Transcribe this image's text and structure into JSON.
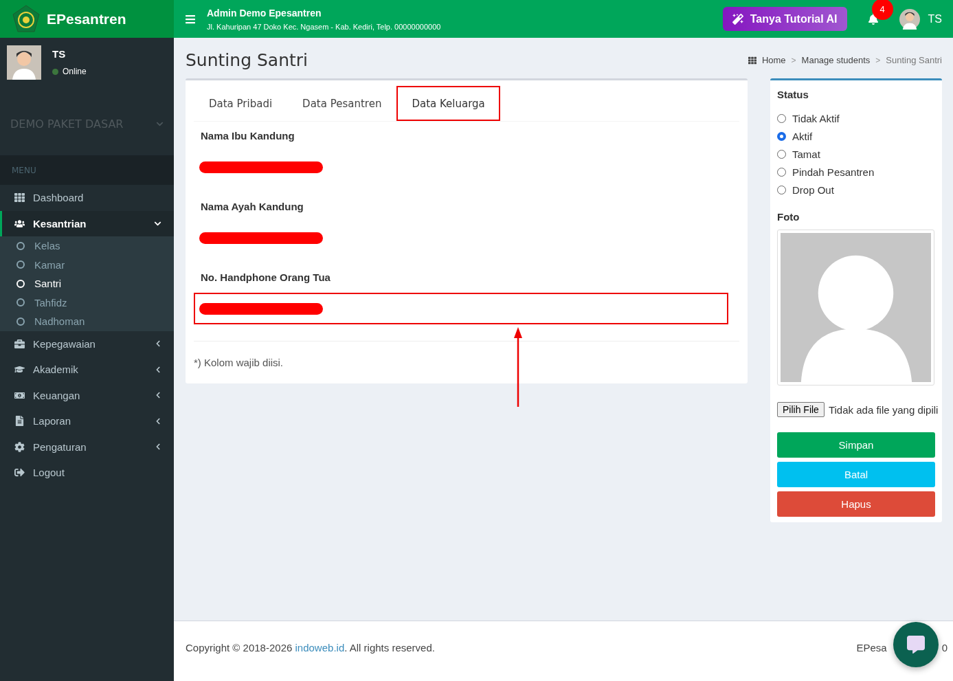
{
  "brand": "EPesantren",
  "header": {
    "title": "Admin Demo Epesantren",
    "address": "Jl. Kahuripan 47 Doko Kec. Ngasem - Kab. Kediri, Telp. 00000000000",
    "ai_button": "Tanya Tutorial AI",
    "notification_count": "4",
    "user_name": "TS"
  },
  "sidebar": {
    "user": {
      "name": "TS",
      "status": "Online"
    },
    "package": "DEMO PAKET DASAR",
    "menu_header": "MENU",
    "items": [
      {
        "label": "Dashboard",
        "kind": "link",
        "selected": false
      },
      {
        "label": "Kesantrian",
        "kind": "tree",
        "expanded": true,
        "selected": true,
        "children": [
          {
            "label": "Kelas",
            "selected": false
          },
          {
            "label": "Kamar",
            "selected": false
          },
          {
            "label": "Santri",
            "selected": true
          },
          {
            "label": "Tahfidz",
            "selected": false
          },
          {
            "label": "Nadhoman",
            "selected": false
          }
        ]
      },
      {
        "label": "Kepegawaian",
        "kind": "tree",
        "expanded": false,
        "selected": false
      },
      {
        "label": "Akademik",
        "kind": "tree",
        "expanded": false,
        "selected": false
      },
      {
        "label": "Keuangan",
        "kind": "tree",
        "expanded": false,
        "selected": false
      },
      {
        "label": "Laporan",
        "kind": "tree",
        "expanded": false,
        "selected": false
      },
      {
        "label": "Pengaturan",
        "kind": "tree",
        "expanded": false,
        "selected": false
      },
      {
        "label": "Logout",
        "kind": "link",
        "selected": false
      }
    ]
  },
  "page": {
    "title": "Sunting Santri",
    "breadcrumbs": [
      "Home",
      "Manage students",
      "Sunting Santri"
    ],
    "breadcrumb_separators": [
      ">",
      ">"
    ]
  },
  "form": {
    "tabs": [
      {
        "label": "Data Pribadi",
        "selected": false,
        "highlighted": false
      },
      {
        "label": "Data Pesantren",
        "selected": false,
        "highlighted": false
      },
      {
        "label": "Data Keluarga",
        "selected": true,
        "highlighted": true
      }
    ],
    "fields": [
      {
        "label": "Nama Ibu Kandung",
        "redacted": true,
        "highlighted": false,
        "arrow": false
      },
      {
        "label": "Nama Ayah Kandung",
        "redacted": true,
        "highlighted": false,
        "arrow": false
      },
      {
        "label": "No. Handphone Orang Tua",
        "redacted": true,
        "highlighted": true,
        "arrow": true
      }
    ],
    "note": "*) Kolom wajib diisi."
  },
  "side": {
    "status_label": "Status",
    "status_options": [
      {
        "label": "Tidak Aktif",
        "selected": false
      },
      {
        "label": "Aktif",
        "selected": true
      },
      {
        "label": "Tamat",
        "selected": false
      },
      {
        "label": "Pindah Pesantren",
        "selected": false
      },
      {
        "label": "Drop Out",
        "selected": false
      }
    ],
    "photo_label": "Foto",
    "file_button": "Pilih File",
    "file_text": "Tidak ada file yang dipili",
    "buttons": [
      {
        "label": "Simpan",
        "kind": "success"
      },
      {
        "label": "Batal",
        "kind": "info"
      },
      {
        "label": "Hapus",
        "kind": "danger"
      }
    ]
  },
  "footer": {
    "copyright_prefix": "Copyright © 2018-2026",
    "link": "indoweb.id",
    "copyright_suffix": ". All rights reserved.",
    "right_start": "EPesa",
    "right_end": "0"
  }
}
